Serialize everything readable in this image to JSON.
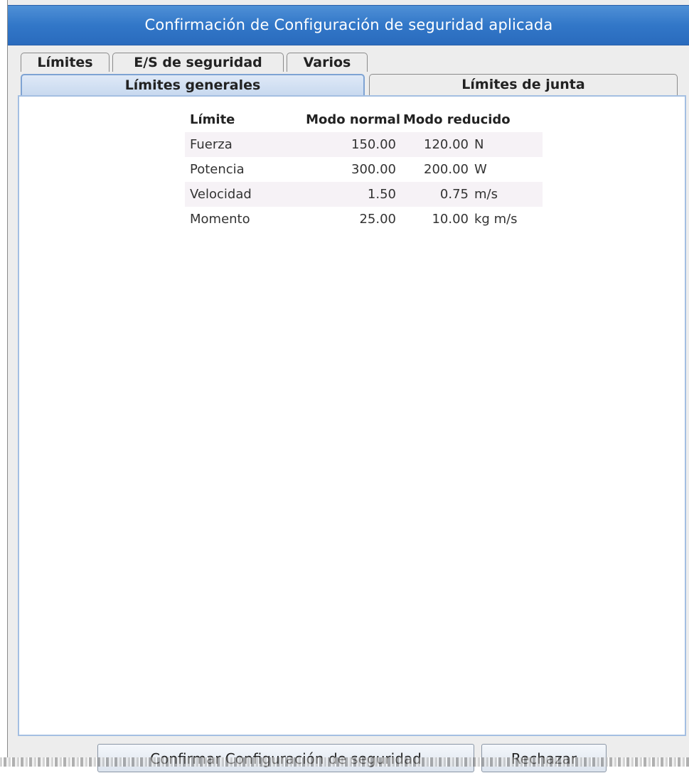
{
  "window": {
    "title": "Confirmación de Configuración de seguridad aplicada"
  },
  "tabs": [
    {
      "label": "Límites",
      "active": true
    },
    {
      "label": "E/S de seguridad",
      "active": false
    },
    {
      "label": "Varios",
      "active": false
    }
  ],
  "subtabs": [
    {
      "label": "Límites generales",
      "active": true
    },
    {
      "label": "Límites de junta",
      "active": false
    }
  ],
  "table": {
    "headers": [
      "Límite",
      "Modo normal",
      "Modo reducido"
    ],
    "rows": [
      {
        "name": "Fuerza",
        "normal": "150.00",
        "reduced": "120.00",
        "unit": "N"
      },
      {
        "name": "Potencia",
        "normal": "300.00",
        "reduced": "200.00",
        "unit": "W"
      },
      {
        "name": "Velocidad",
        "normal": "1.50",
        "reduced": "0.75",
        "unit": "m/s"
      },
      {
        "name": "Momento",
        "normal": "25.00",
        "reduced": "10.00",
        "unit": "kg m/s"
      }
    ]
  },
  "buttons": {
    "confirm": "Confirmar Configuración de seguridad",
    "reject": "Rechazar"
  },
  "colors": {
    "title_bar": "#3277c8",
    "active_tab": "#c8d9ef",
    "row_stripe": "#f6f2f6"
  }
}
